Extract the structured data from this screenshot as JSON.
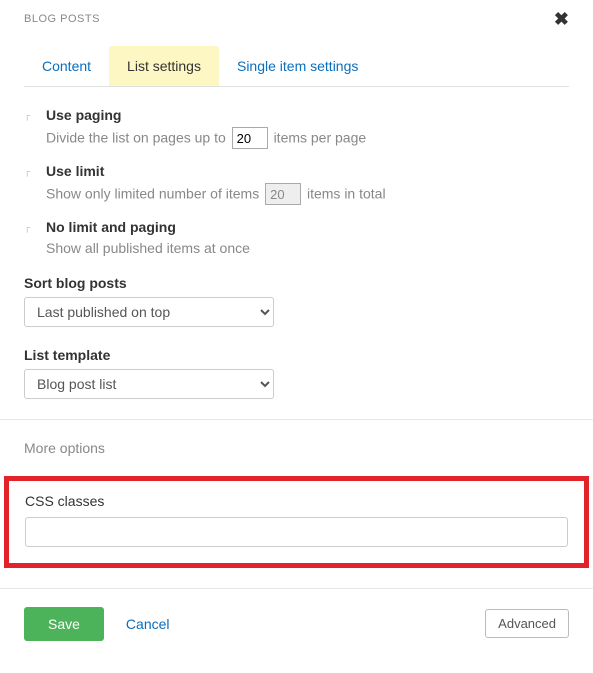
{
  "header": {
    "title": "BLOG POSTS"
  },
  "tabs": {
    "content": "Content",
    "list_settings": "List settings",
    "single_item": "Single item settings"
  },
  "paging": {
    "label": "Use paging",
    "desc_before": "Divide the list on pages up to",
    "value": "20",
    "desc_after": "items per page"
  },
  "limit": {
    "label": "Use limit",
    "desc_before": "Show only limited number of items",
    "value": "20",
    "desc_after": "items in total"
  },
  "nolimit": {
    "label": "No limit and paging",
    "desc": "Show all published items at once"
  },
  "sort": {
    "label": "Sort blog posts",
    "value": "Last published on top"
  },
  "template": {
    "label": "List template",
    "value": "Blog post list"
  },
  "more_options": "More options",
  "css": {
    "label": "CSS classes",
    "value": ""
  },
  "footer": {
    "save": "Save",
    "cancel": "Cancel",
    "advanced": "Advanced"
  }
}
